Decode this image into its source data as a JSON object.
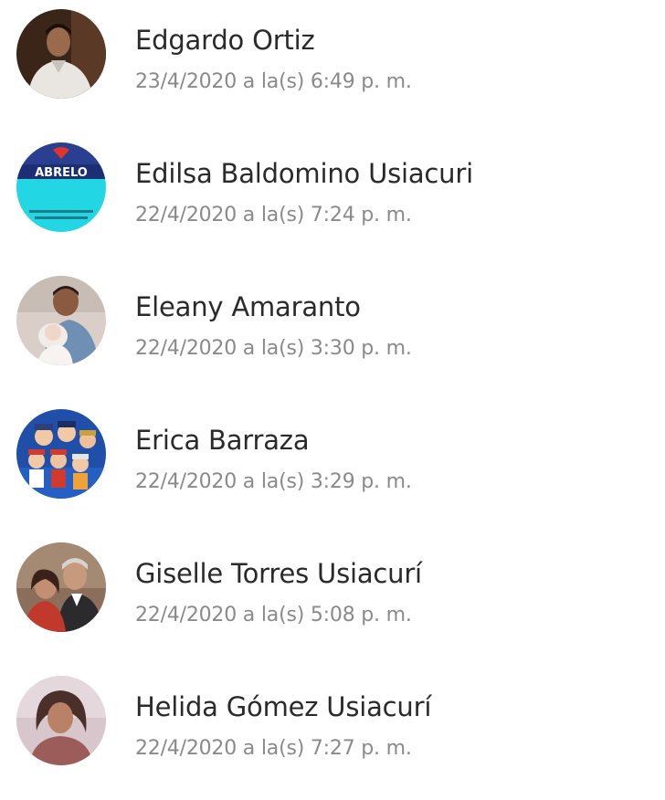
{
  "contacts": [
    {
      "name": "Edgardo Ortiz",
      "time": "23/4/2020 a la(s) 6:49 p. m.",
      "avatar_icon": "profile-photo-man-white-shirt"
    },
    {
      "name": "Edilsa Baldomino Usiacuri",
      "time": "22/4/2020 a la(s) 7:24 p. m.",
      "avatar_icon": "profile-image-abrelo-graphic",
      "avatar_text": "ABRELO"
    },
    {
      "name": "Eleany Amaranto",
      "time": "22/4/2020 a la(s) 3:30 p. m.",
      "avatar_icon": "profile-photo-person-with-baby"
    },
    {
      "name": "Erica Barraza",
      "time": "22/4/2020 a la(s) 3:29 p. m.",
      "avatar_icon": "profile-image-cartoon-characters"
    },
    {
      "name": "Giselle Torres Usiacurí",
      "time": "22/4/2020 a la(s) 5:08 p. m.",
      "avatar_icon": "profile-photo-couple"
    },
    {
      "name": "Helida Gómez Usiacurí",
      "time": "22/4/2020 a la(s) 7:27 p. m.",
      "avatar_icon": "profile-photo-woman"
    }
  ]
}
